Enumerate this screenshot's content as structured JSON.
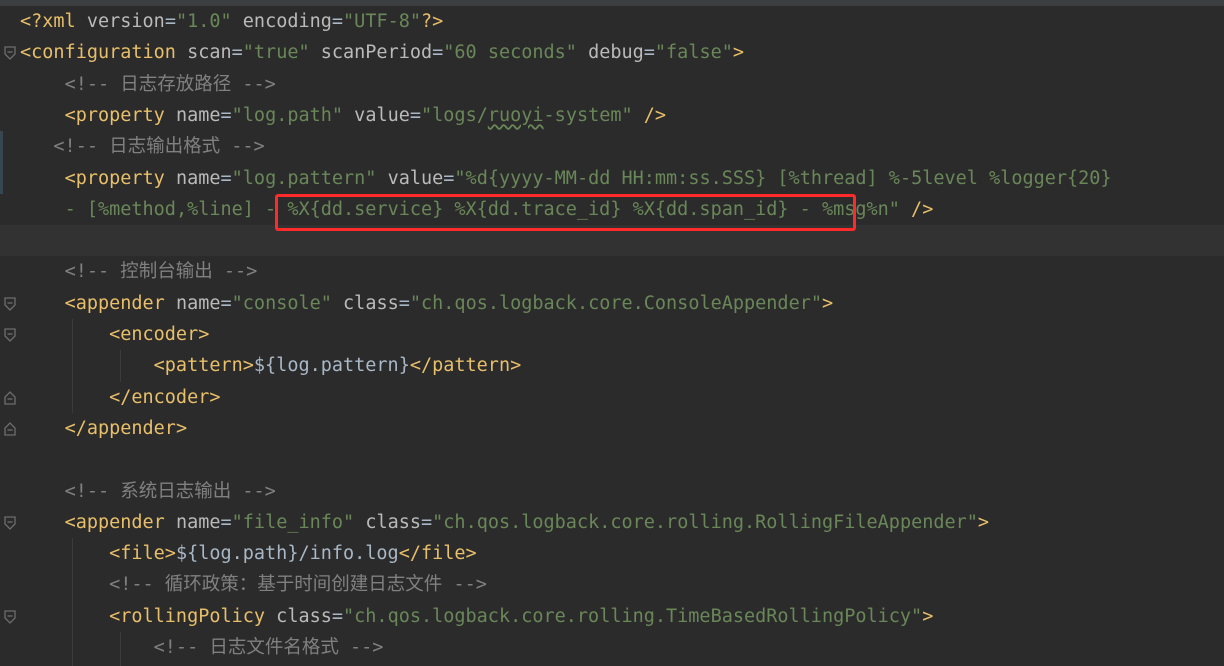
{
  "editor": {
    "language": "xml",
    "highlight_color": "#ff2b2b",
    "lines": [
      {
        "indent": "",
        "parts": [
          [
            "pi",
            "<?"
          ],
          [
            "tag",
            "xml"
          ],
          [
            "attr",
            " version"
          ],
          [
            "txt",
            "="
          ],
          [
            "val",
            "\"1.0\""
          ],
          [
            "attr",
            " encoding"
          ],
          [
            "txt",
            "="
          ],
          [
            "val",
            "\"UTF-8\""
          ],
          [
            "pi",
            "?>"
          ]
        ]
      },
      {
        "indent": "",
        "parts": [
          [
            "tag",
            "<configuration"
          ],
          [
            "attr",
            " scan"
          ],
          [
            "txt",
            "="
          ],
          [
            "val",
            "\"true\""
          ],
          [
            "attr",
            " scanPeriod"
          ],
          [
            "txt",
            "="
          ],
          [
            "val",
            "\"60 seconds\""
          ],
          [
            "attr",
            " debug"
          ],
          [
            "txt",
            "="
          ],
          [
            "val",
            "\"false\""
          ],
          [
            "tag",
            ">"
          ]
        ]
      },
      {
        "indent": "    ",
        "parts": [
          [
            "cmt",
            "<!-- 日志存放路径 -->"
          ]
        ]
      },
      {
        "indent": "    ",
        "parts": [
          [
            "tag",
            "<property"
          ],
          [
            "attr",
            " name"
          ],
          [
            "txt",
            "="
          ],
          [
            "val",
            "\"log.path\""
          ],
          [
            "attr",
            " value"
          ],
          [
            "txt",
            "="
          ],
          [
            "val",
            "\"logs/"
          ],
          [
            "valtypo",
            "ruoyi"
          ],
          [
            "val",
            "-system\""
          ],
          [
            "tag",
            " />"
          ]
        ]
      },
      {
        "indent": "   ",
        "parts": [
          [
            "cmt",
            "<!-- 日志输出格式 -->"
          ]
        ]
      },
      {
        "indent": "    ",
        "parts": [
          [
            "tag",
            "<property"
          ],
          [
            "attr",
            " name"
          ],
          [
            "txt",
            "="
          ],
          [
            "val",
            "\"log.pattern\""
          ],
          [
            "attr",
            " value"
          ],
          [
            "txt",
            "="
          ],
          [
            "val",
            "\"%d{yyyy-MM-dd HH:mm:ss.SSS} [%thread] %-5level %logger{20}"
          ]
        ]
      },
      {
        "indent": "    ",
        "parts": [
          [
            "val",
            "- [%method,%line] - %X{dd.service} %X{dd.trace_id} %X{dd.span_id} - %msg%n\""
          ],
          [
            "tag",
            " />"
          ]
        ]
      },
      {
        "indent": "",
        "parts": []
      },
      {
        "indent": "    ",
        "parts": [
          [
            "cmt",
            "<!-- 控制台输出 -->"
          ]
        ]
      },
      {
        "indent": "    ",
        "parts": [
          [
            "tag",
            "<appender"
          ],
          [
            "attr",
            " name"
          ],
          [
            "txt",
            "="
          ],
          [
            "val",
            "\"console\""
          ],
          [
            "attr",
            " class"
          ],
          [
            "txt",
            "="
          ],
          [
            "val",
            "\"ch.qos.logback.core.ConsoleAppender\""
          ],
          [
            "tag",
            ">"
          ]
        ]
      },
      {
        "indent": "        ",
        "parts": [
          [
            "tag",
            "<encoder>"
          ]
        ]
      },
      {
        "indent": "            ",
        "parts": [
          [
            "tag",
            "<pattern>"
          ],
          [
            "txt",
            "${log.pattern}"
          ],
          [
            "tag",
            "</pattern>"
          ]
        ]
      },
      {
        "indent": "        ",
        "parts": [
          [
            "tag",
            "</encoder>"
          ]
        ]
      },
      {
        "indent": "    ",
        "parts": [
          [
            "tag",
            "</appender>"
          ]
        ]
      },
      {
        "indent": "",
        "parts": []
      },
      {
        "indent": "    ",
        "parts": [
          [
            "cmt",
            "<!-- 系统日志输出 -->"
          ]
        ]
      },
      {
        "indent": "    ",
        "parts": [
          [
            "tag",
            "<appender"
          ],
          [
            "attr",
            " name"
          ],
          [
            "txt",
            "="
          ],
          [
            "val",
            "\"file_info\""
          ],
          [
            "attr",
            " class"
          ],
          [
            "txt",
            "="
          ],
          [
            "val",
            "\"ch.qos.logback.core.rolling.RollingFileAppender\""
          ],
          [
            "tag",
            ">"
          ]
        ]
      },
      {
        "indent": "        ",
        "parts": [
          [
            "tag",
            "<file>"
          ],
          [
            "txt",
            "${log.path}/info.log"
          ],
          [
            "tag",
            "</file>"
          ]
        ]
      },
      {
        "indent": "        ",
        "parts": [
          [
            "cmt",
            "<!-- 循环政策：基于时间创建日志文件 -->"
          ]
        ]
      },
      {
        "indent": "        ",
        "parts": [
          [
            "tag",
            "<rollingPolicy"
          ],
          [
            "attr",
            " class"
          ],
          [
            "txt",
            "="
          ],
          [
            "val",
            "\"ch.qos.logback.core.rolling.TimeBasedRollingPolicy\""
          ],
          [
            "tag",
            ">"
          ]
        ]
      },
      {
        "indent": "            ",
        "parts": [
          [
            "cmt",
            "<!-- 日志文件名格式 -->"
          ]
        ]
      }
    ]
  }
}
